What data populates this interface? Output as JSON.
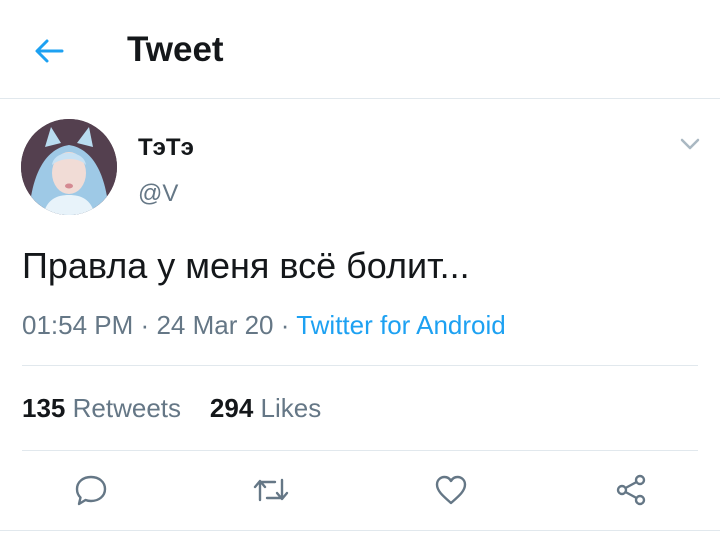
{
  "header": {
    "title": "Tweet",
    "back_icon": "arrow-left-icon"
  },
  "tweet": {
    "author_name": "ТэТэ",
    "author_handle": "@V",
    "text": "Правла у меня всё болит...",
    "time": "01:54 PM",
    "separator": "·",
    "date": "24 Mar 20",
    "source": "Twitter for Android",
    "retweets_count": "135",
    "retweets_label": "Retweets",
    "likes_count": "294",
    "likes_label": "Likes"
  },
  "actions": [
    "reply-icon",
    "retweet-icon",
    "like-icon",
    "share-icon"
  ],
  "colors": {
    "accent": "#1da1f2",
    "secondary_text": "#657786",
    "divider": "#e1e8ed"
  }
}
